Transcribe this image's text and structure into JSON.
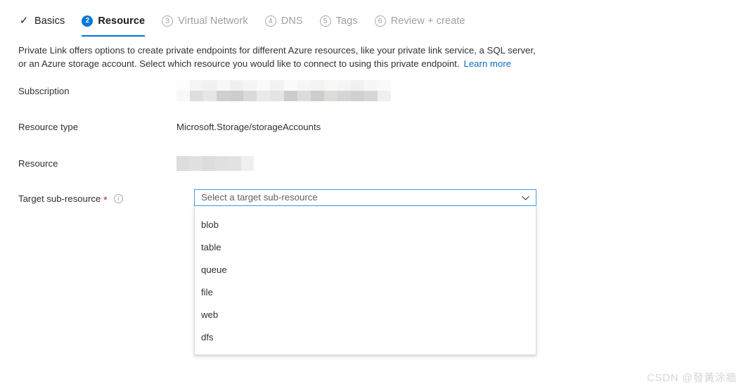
{
  "wizard": {
    "tabs": [
      {
        "label": "Basics",
        "marker": "✓",
        "state": "done"
      },
      {
        "label": "Resource",
        "marker": "2",
        "state": "current"
      },
      {
        "label": "Virtual Network",
        "marker": "3",
        "state": "upcoming"
      },
      {
        "label": "DNS",
        "marker": "4",
        "state": "upcoming"
      },
      {
        "label": "Tags",
        "marker": "5",
        "state": "upcoming"
      },
      {
        "label": "Review + create",
        "marker": "6",
        "state": "upcoming"
      }
    ]
  },
  "description": {
    "text": "Private Link offers options to create private endpoints for different Azure resources, like your private link service, a SQL server, or an Azure storage account. Select which resource you would like to connect to using this private endpoint.",
    "link_label": "Learn more"
  },
  "form": {
    "subscription": {
      "label": "Subscription",
      "value": "",
      "redacted": true
    },
    "resource_type": {
      "label": "Resource type",
      "value": "Microsoft.Storage/storageAccounts"
    },
    "resource": {
      "label": "Resource",
      "value": "",
      "redacted": true
    },
    "target_sub_resource": {
      "label": "Target sub-resource",
      "required_marker": "*",
      "info_glyph": "i",
      "placeholder": "Select a target sub-resource",
      "value": "",
      "options": [
        "blob",
        "table",
        "queue",
        "file",
        "web",
        "dfs"
      ]
    }
  },
  "watermark": {
    "text": "CSDN @發黃涂牆"
  },
  "colors": {
    "accent": "#0078d4",
    "link": "#0f6cbd",
    "required": "#a4262c",
    "focus_border": "#3f9bed",
    "text": "#323130",
    "muted": "#a19f9d"
  }
}
